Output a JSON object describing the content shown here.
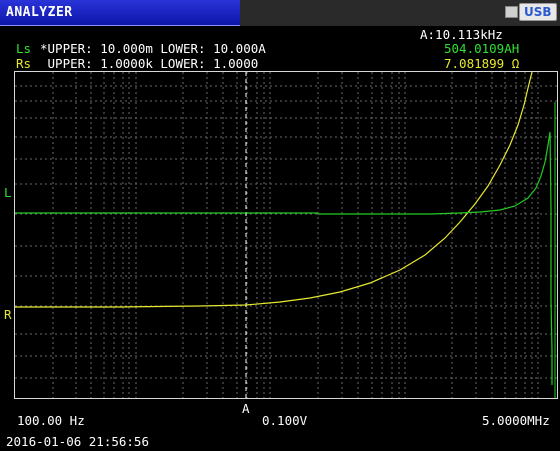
{
  "window": {
    "title": "ANALYZER",
    "usb_label": "USB"
  },
  "header": {
    "frequency": "A:10.113kHz",
    "ls": {
      "name": "Ls",
      "limits": "*UPPER: 10.000m LOWER: 10.000А",
      "value": "504.0109АH"
    },
    "rs": {
      "name": "Rs",
      "limits": " UPPER: 1.0000k LOWER: 1.0000",
      "value": "7.081899 Ω"
    }
  },
  "graph": {
    "left_marker_l": "L",
    "left_marker_r": "R",
    "cursor_label": "A",
    "x_start": "100.00 Hz",
    "amplitude": "0.100V",
    "x_end": "5.0000MHz"
  },
  "status": {
    "datetime": "2016-01-06 21:56:56"
  },
  "colors": {
    "ls_trace": "#22cc22",
    "rs_trace": "#eeee22",
    "title_blue": "#1a22c0",
    "grid": "#888888"
  }
}
